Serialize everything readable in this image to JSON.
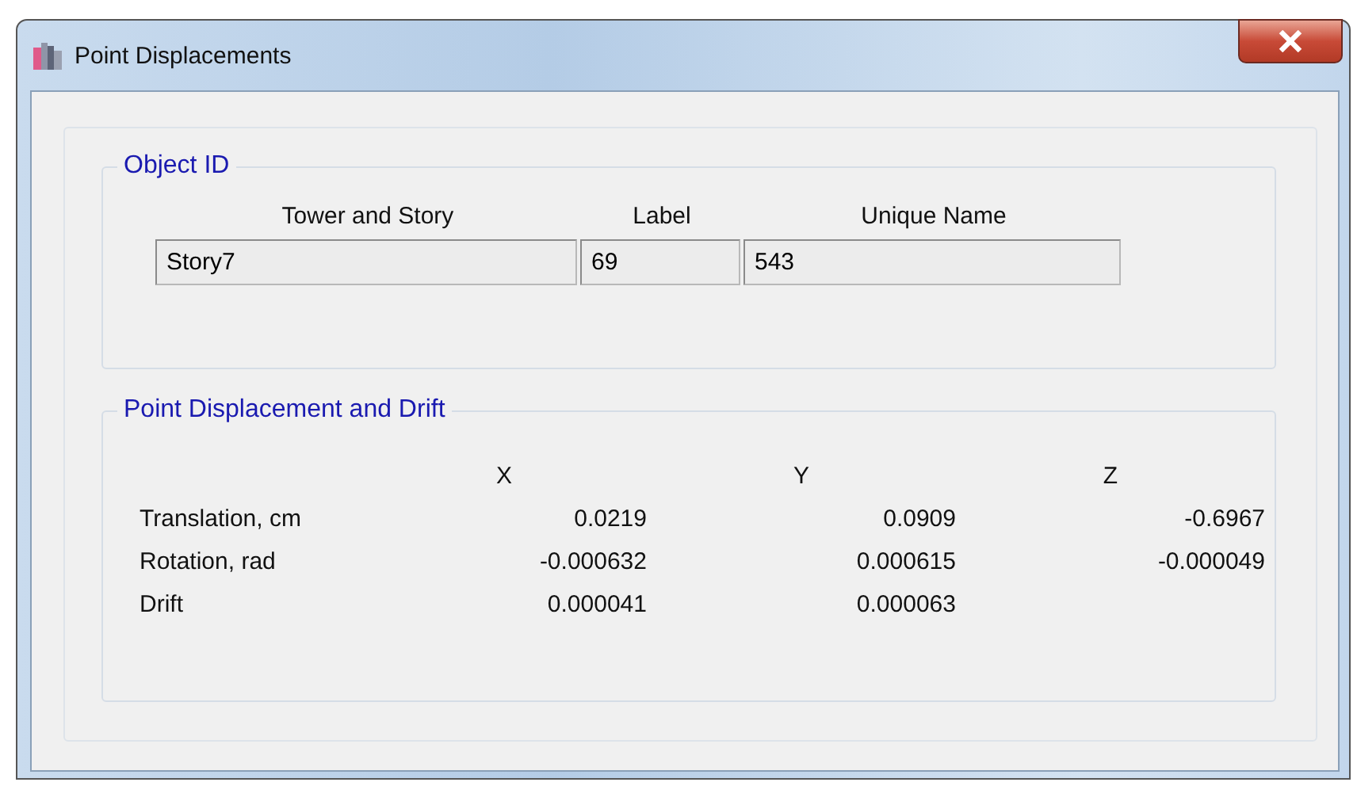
{
  "window": {
    "title": "Point Displacements"
  },
  "object_id": {
    "title": "Object ID",
    "columns": [
      "Tower and Story",
      "Label",
      "Unique Name"
    ],
    "values": [
      "Story7",
      "69",
      "543"
    ]
  },
  "displacement": {
    "title": "Point Displacement and Drift",
    "columns": [
      "X",
      "Y",
      "Z"
    ],
    "rows": [
      {
        "label": "Translation, cm",
        "values": [
          "0.0219",
          "0.0909",
          "-0.6967"
        ]
      },
      {
        "label": "Rotation, rad",
        "values": [
          "-0.000632",
          "0.000615",
          "-0.000049"
        ]
      },
      {
        "label": "Drift",
        "values": [
          "0.000041",
          "0.000063"
        ]
      }
    ]
  }
}
